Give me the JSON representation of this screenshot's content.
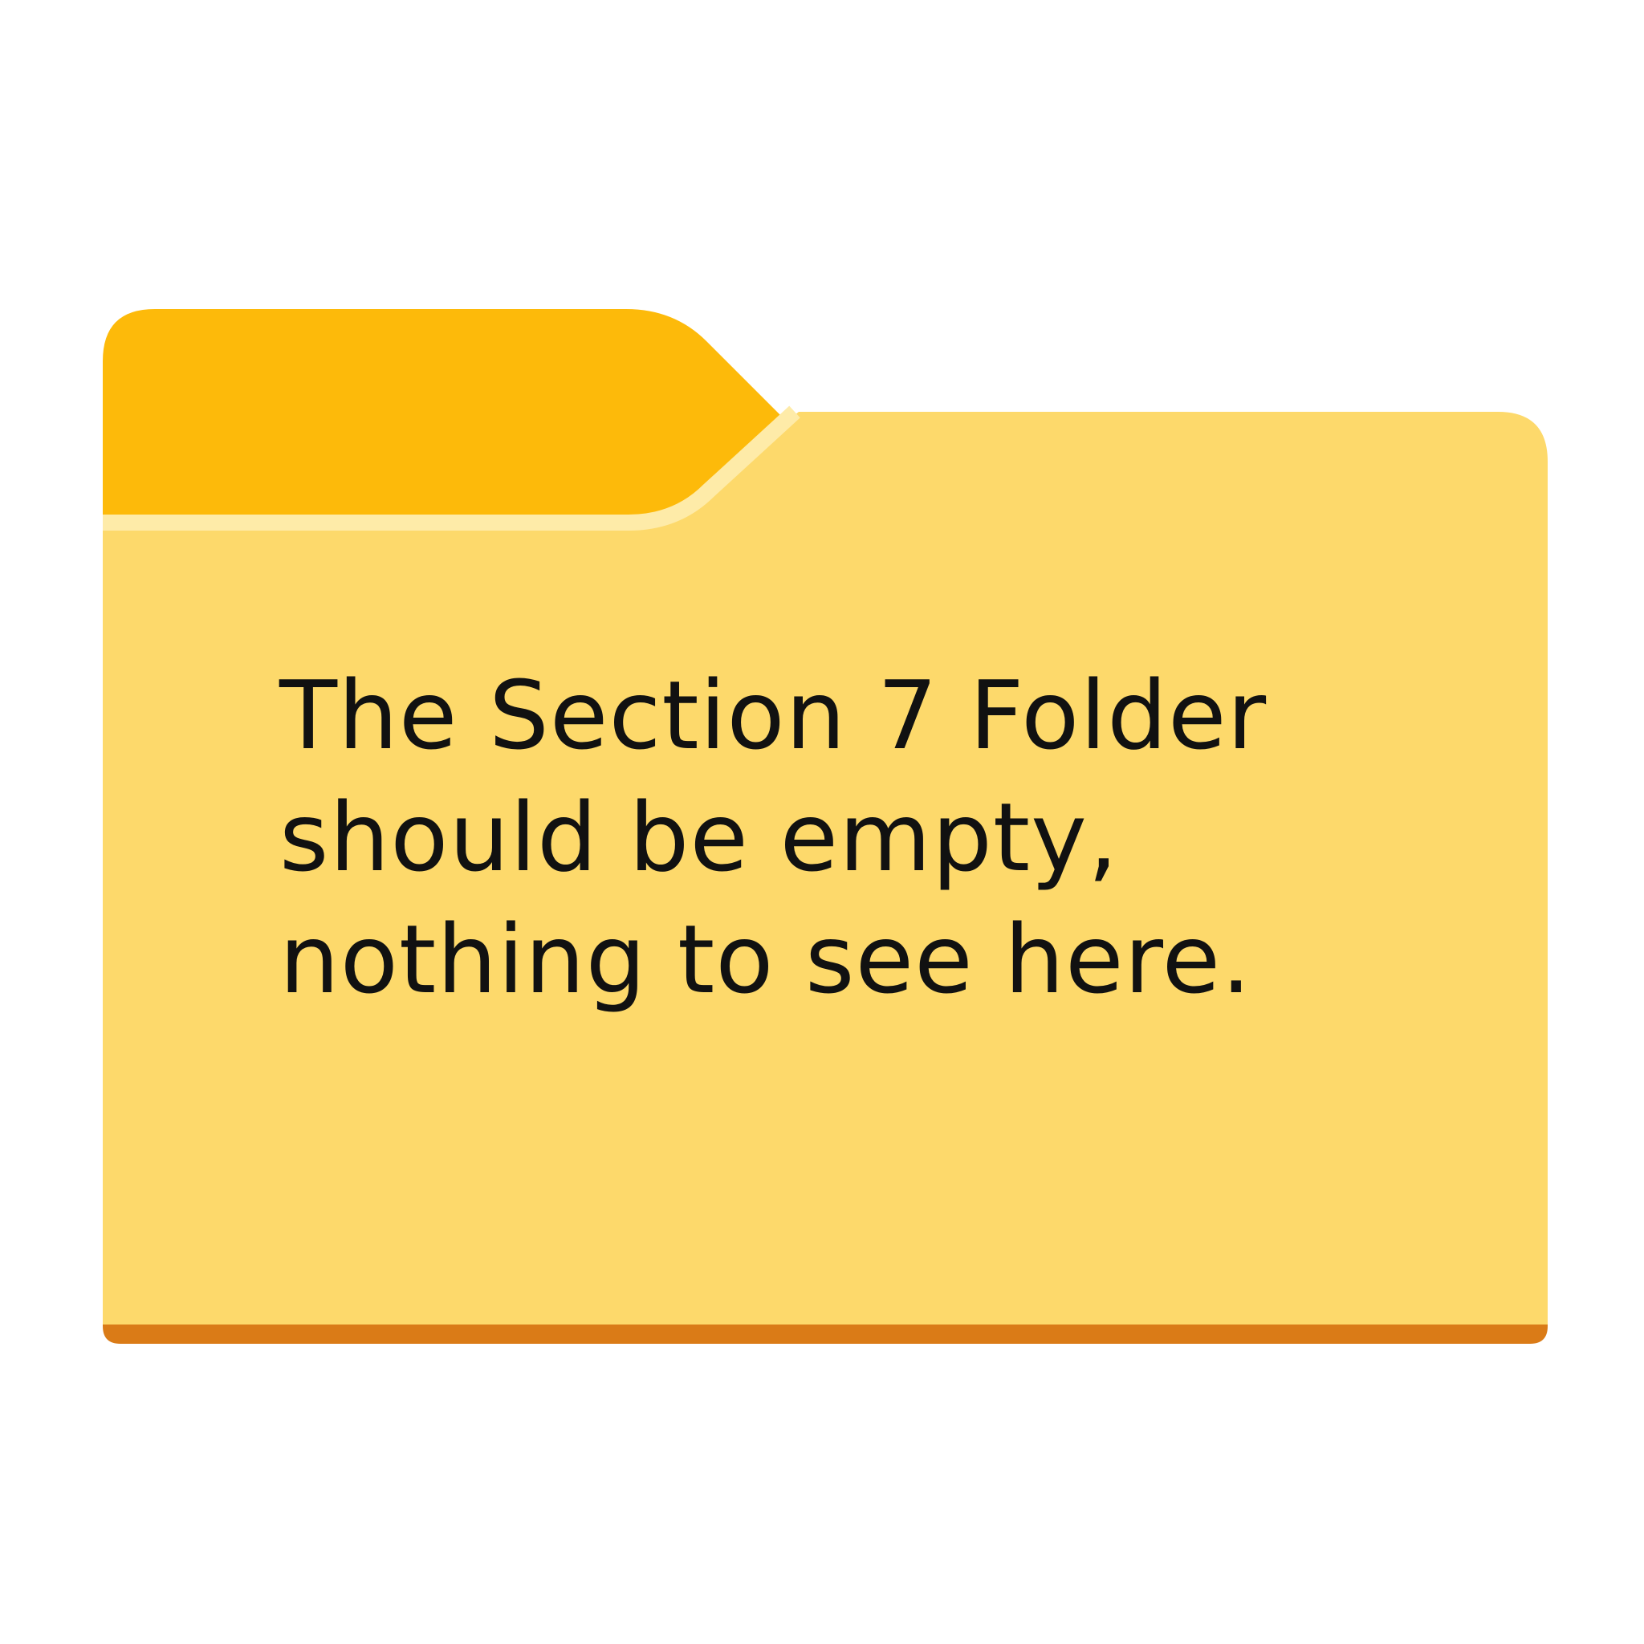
{
  "message": {
    "line1": "The Section 7 Folder",
    "line2": "should be empty,",
    "line3": "nothing to see here."
  },
  "colors": {
    "folder_tab": "#FDBA0A",
    "folder_body": "#FDD96B",
    "folder_highlight": "#FEEBA8",
    "folder_bottom_edge": "#DA7B17",
    "text": "#111111",
    "background": "#FFFFFF"
  },
  "icons": {
    "folder": "folder-icon"
  }
}
